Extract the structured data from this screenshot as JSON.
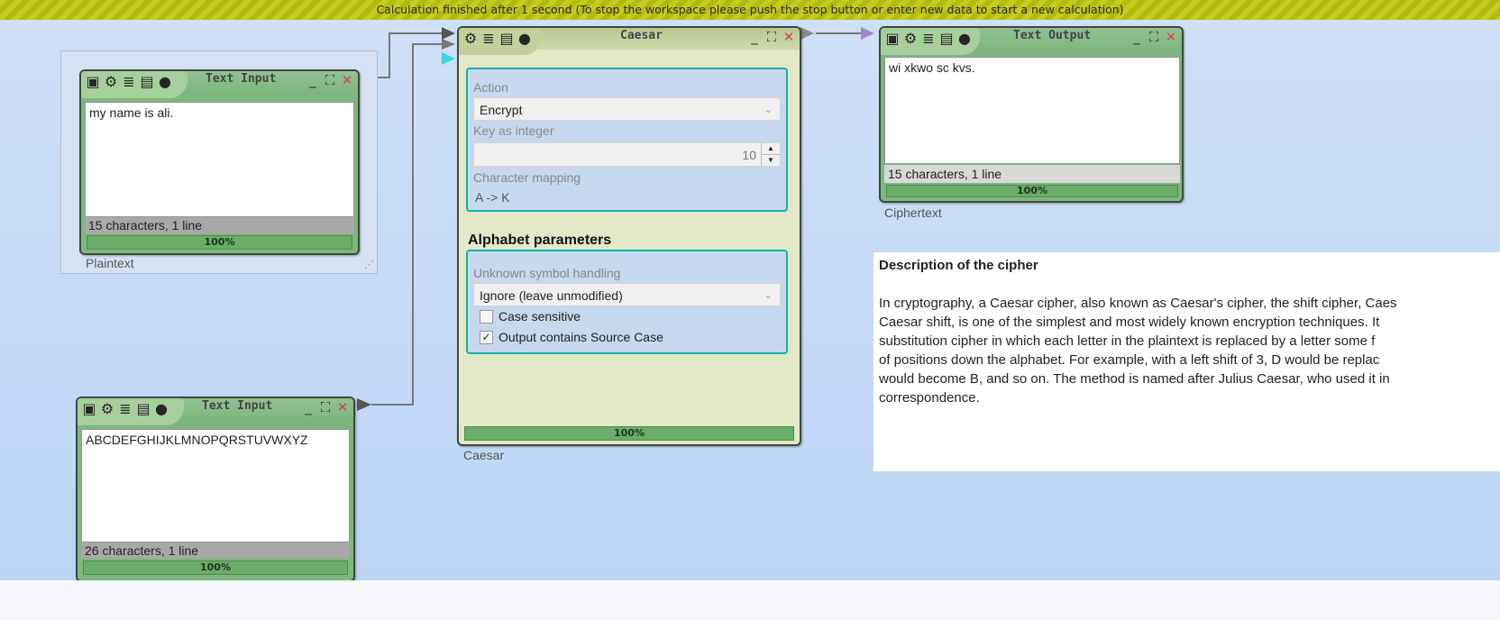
{
  "status": {
    "message": "Calculation finished after 1 second (To stop the workspace please push the stop button or enter new data to start a new calculation)"
  },
  "icons": {
    "image": "image-icon",
    "settings": "gear-icon",
    "log": "list-icon",
    "clipboard": "clipboard-icon",
    "help": "help-bubble-icon",
    "minimize": "minimize-icon",
    "maximize": "maximize-icon",
    "close": "close-icon"
  },
  "plaintext_input": {
    "title": "Text Input",
    "text": "my name is ali.",
    "info": "15 characters,  1 line",
    "progress": "100%",
    "caption": "Plaintext"
  },
  "alphabet_input": {
    "title": "Text Input",
    "text": "ABCDEFGHIJKLMNOPQRSTUVWXYZ",
    "info": "26 characters,  1 line",
    "progress": "100%"
  },
  "caesar": {
    "title": "Caesar",
    "action_label": "Action",
    "action_value": "Encrypt",
    "key_label": "Key as integer",
    "key_value": "10",
    "mapping_label": "Character mapping",
    "mapping_value": "A -> K",
    "alphabet_heading": "Alphabet parameters",
    "unknown_label": "Unknown symbol handling",
    "unknown_value": "Ignore (leave unmodified)",
    "case_sensitive_label": "Case sensitive",
    "case_sensitive_checked": false,
    "source_case_label": "Output contains Source Case",
    "source_case_checked": true,
    "progress": "100%",
    "caption": "Caesar"
  },
  "output": {
    "title": "Text Output",
    "text": "wi xkwo sc kvs.",
    "info": "15 characters,  1 line",
    "progress": "100%",
    "caption": "Ciphertext"
  },
  "description": {
    "heading": "Description of the cipher",
    "lines": [
      "In cryptography, a Caesar cipher, also known as Caesar's cipher, the shift cipher, Caes",
      "Caesar shift, is one of the simplest and most widely known encryption techniques. It",
      "substitution cipher in which each letter in the plaintext is replaced by a letter some f",
      "of positions down the alphabet. For example, with a left shift of 3, D would be replac",
      "would become B, and so on. The method is named after Julius Caesar, who used it in",
      "correspondence."
    ]
  },
  "colors": {
    "accent": "#12b3a7",
    "window": "#7eb77e",
    "progress": "#69ad69",
    "status": "#c4cc1e"
  }
}
